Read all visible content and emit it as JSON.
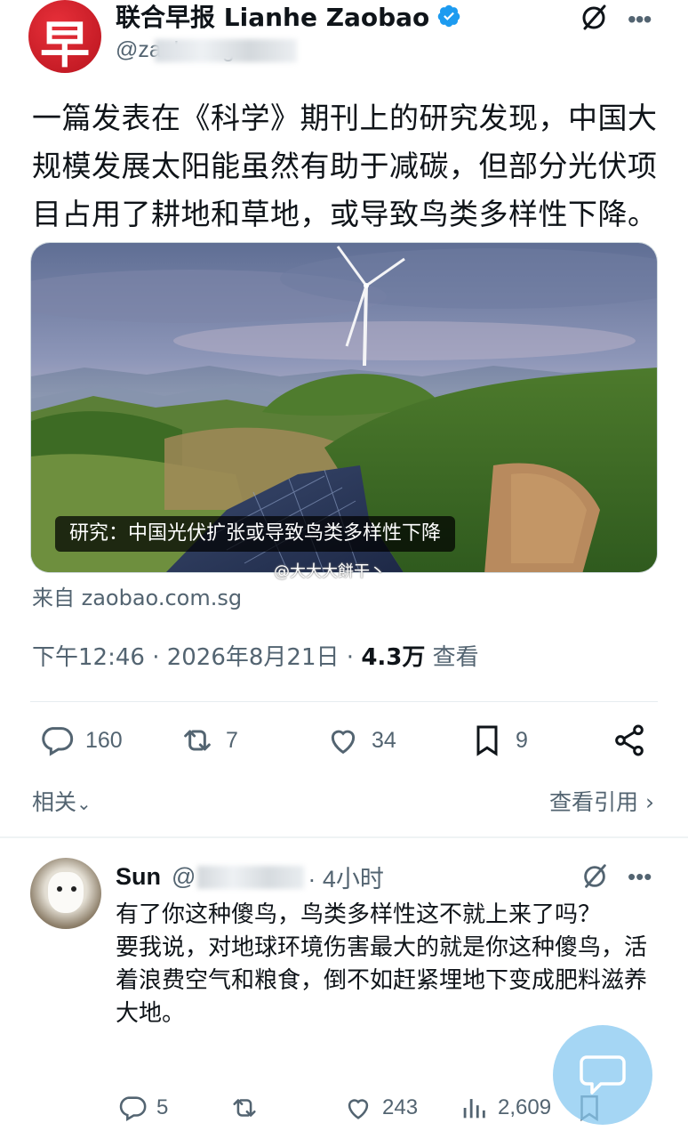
{
  "post": {
    "display_name": "联合早报 Lianhe Zaobao",
    "handle": "@zaobaosg",
    "avatar_glyph": "早",
    "text": "一篇发表在《科学》期刊上的研究发现，中国大规模发展太阳能虽然有助于减碳，但部分光伏项目占用了耕地和草地，或导致鸟类多样性下降。",
    "media_caption": "研究：中国光伏扩张或导致鸟类多样性下降",
    "watermark": "@大大大餅干丶",
    "source": "来自 zaobao.com.sg",
    "time": "下午12:46 · 2026年8月21日 · ",
    "views": "4.3万",
    "views_label": "查看",
    "stats": {
      "replies": "160",
      "reposts": "7",
      "likes": "34",
      "bookmarks": "9"
    },
    "related_label": "相关",
    "quotes_label": "查看引用"
  },
  "reply": {
    "name": "Sun",
    "handle_prefix": "@",
    "time": "· 4小时",
    "text_line1": "有了你这种傻鸟，鸟类多样性这不就上来了吗？",
    "text_line2": "要我说，对地球环境伤害最大的就是你这种傻鸟，活着浪费空气和粮食，倒不如赶紧埋地下变成肥料滋养大地。",
    "stats": {
      "replies": "5",
      "likes": "243",
      "views": "2,609"
    }
  },
  "colors": {
    "brand_red": "#d21f2b",
    "verified_blue": "#1d9bf0",
    "muted_text": "#536471",
    "fab": "#87c8f0"
  }
}
